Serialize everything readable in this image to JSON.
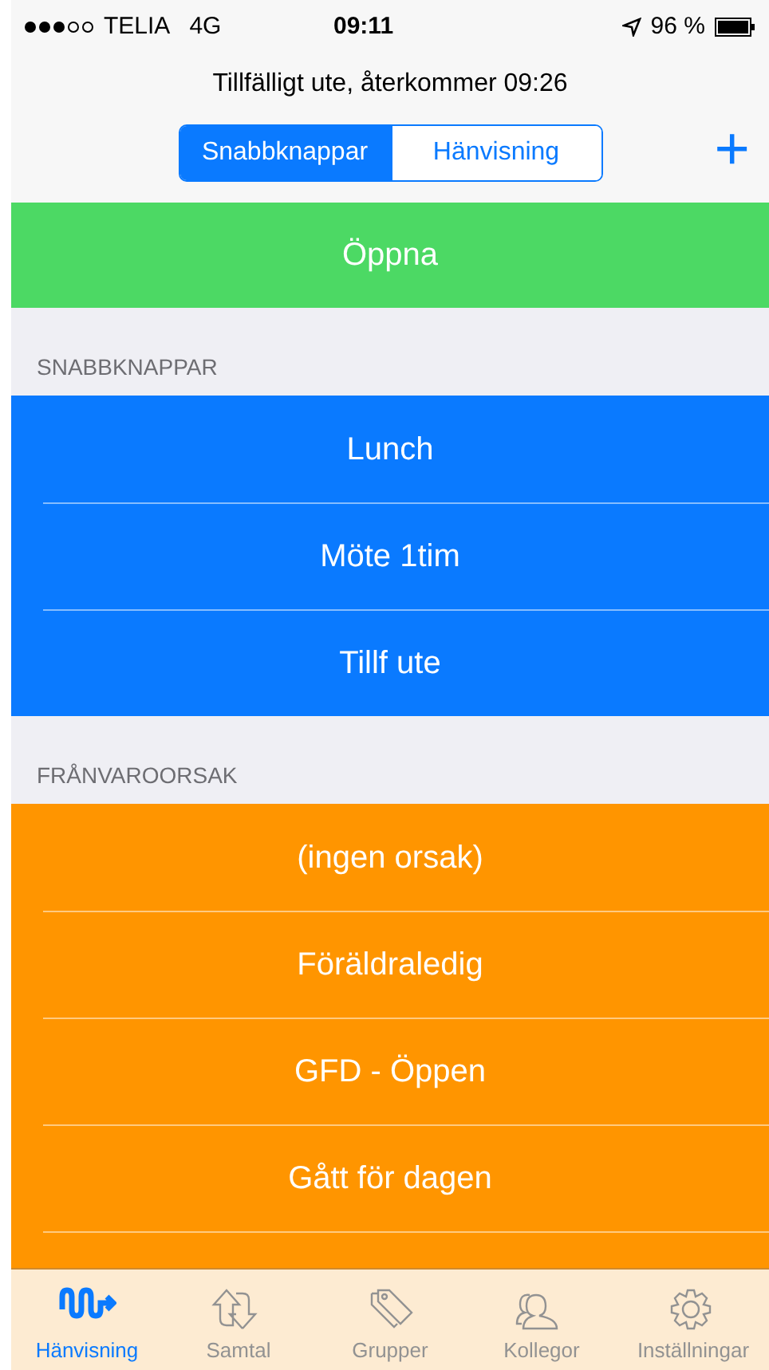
{
  "status_bar": {
    "carrier": "TELIA",
    "network": "4G",
    "time": "09:11",
    "battery": "96 %"
  },
  "status_text": "Tillfälligt ute, återkommer 09:26",
  "segments": [
    {
      "label": "Snabbknappar",
      "selected": true
    },
    {
      "label": "Hänvisning",
      "selected": false
    }
  ],
  "add_button": "+",
  "open_button": "Öppna",
  "sections": [
    {
      "header": "SNABBKNAPPAR",
      "kind": "quick",
      "rows": [
        "Lunch",
        "Möte 1tim",
        "Tillf ute"
      ]
    },
    {
      "header": "FRÅNVAROORSAK",
      "kind": "reason",
      "rows": [
        "(ingen orsak)",
        "Föräldraledig",
        "GFD - Öppen",
        "Gått för dagen"
      ]
    }
  ],
  "tab_bar": [
    {
      "label": "Hänvisning",
      "kind": "wave",
      "selected": true
    },
    {
      "label": "Samtal",
      "kind": "arrows",
      "selected": false
    },
    {
      "label": "Grupper",
      "kind": "tags",
      "selected": false
    },
    {
      "label": "Kollegor",
      "kind": "people",
      "selected": false
    },
    {
      "label": "Inställningar",
      "kind": "gear",
      "selected": false
    }
  ]
}
